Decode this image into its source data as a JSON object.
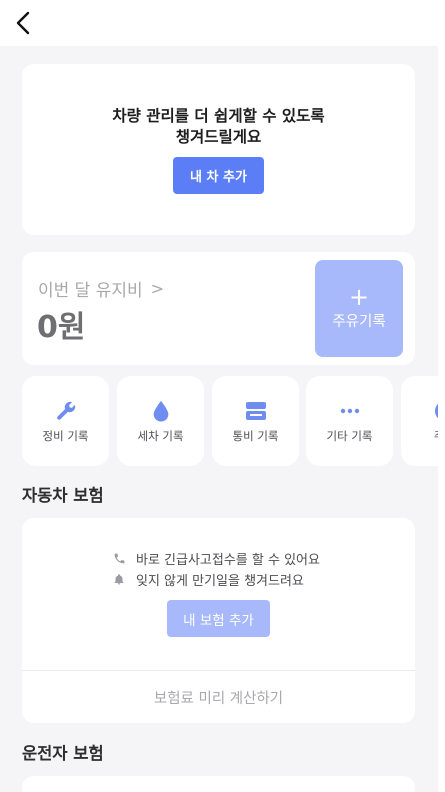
{
  "header": {
    "back_icon": "chevron-left-icon"
  },
  "promo": {
    "line1": "차량 관리를 더 쉽게할 수 있도록",
    "line2": "챙겨드릴게요",
    "button": "내 차 추가"
  },
  "maintenance": {
    "title": "이번 달 유지비",
    "chevron": ">",
    "amount": "0원",
    "fuel_plus": "+",
    "fuel_label": "주유기록"
  },
  "categories": [
    {
      "label": "정비 기록",
      "icon": "wrench-icon"
    },
    {
      "label": "세차 기록",
      "icon": "water-drop-icon"
    },
    {
      "label": "통비 기록",
      "icon": "ticket-icon"
    },
    {
      "label": "기타 기록",
      "icon": "more-dots-icon"
    },
    {
      "label": "주차",
      "icon": "parking-icon"
    }
  ],
  "insurance": {
    "section_title": "자동차 보험",
    "line1": "바로 긴급사고접수를 할 수 있어요",
    "line2": "잊지 않게 만기일을 챙겨드려요",
    "add_button": "내 보험 추가",
    "calc_link": "보험료 미리 계산하기"
  },
  "driver_insurance": {
    "section_title": "운전자 보험"
  },
  "colors": {
    "accent": "#5b7ef6",
    "accent_light": "#a7b9fb",
    "background": "#f5f5f7",
    "icon": "#6f8df0"
  }
}
